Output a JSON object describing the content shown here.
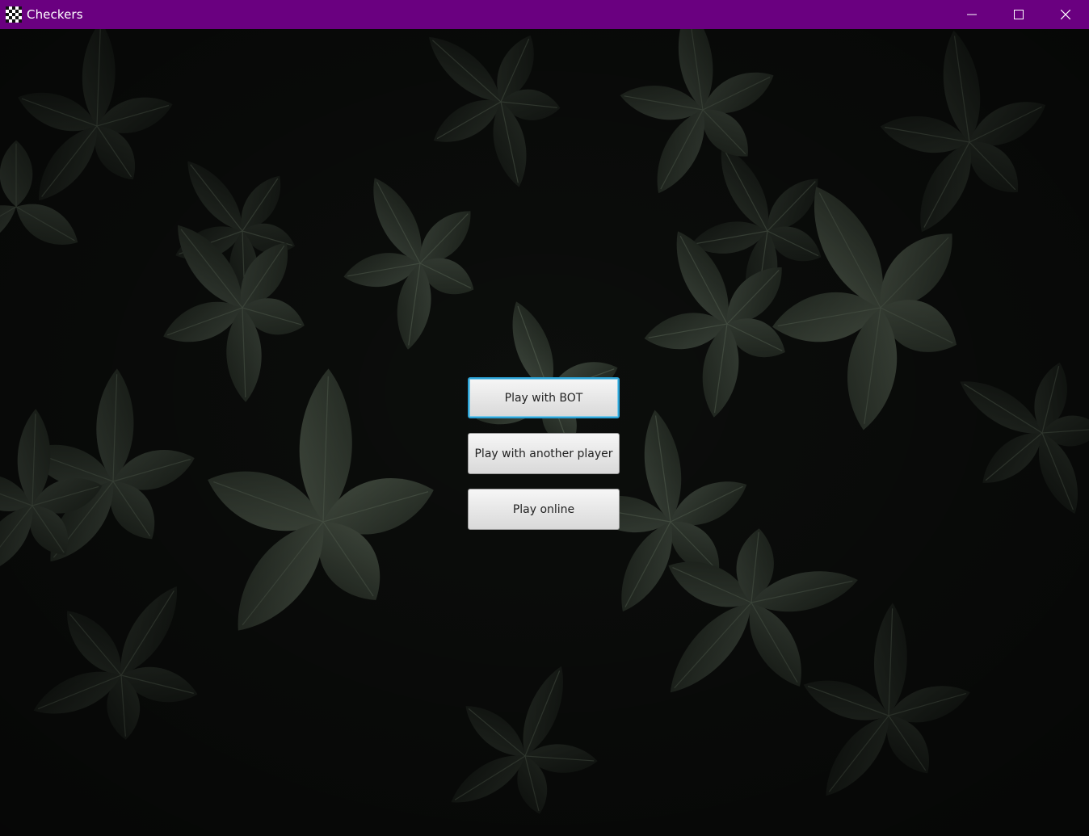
{
  "window": {
    "title": "Checkers",
    "titlebar_color": "#6a0080",
    "icon": "checkerboard-icon",
    "controls": [
      "minimize-icon",
      "maximize-icon",
      "close-icon"
    ]
  },
  "background": {
    "description_icon": "leaves-background"
  },
  "menu": {
    "play_bot_label": "Play with BOT",
    "play_local_label": "Play with another player",
    "play_online_label": "Play online",
    "focused_button": "play_bot",
    "focus_color": "#2da3d6"
  }
}
